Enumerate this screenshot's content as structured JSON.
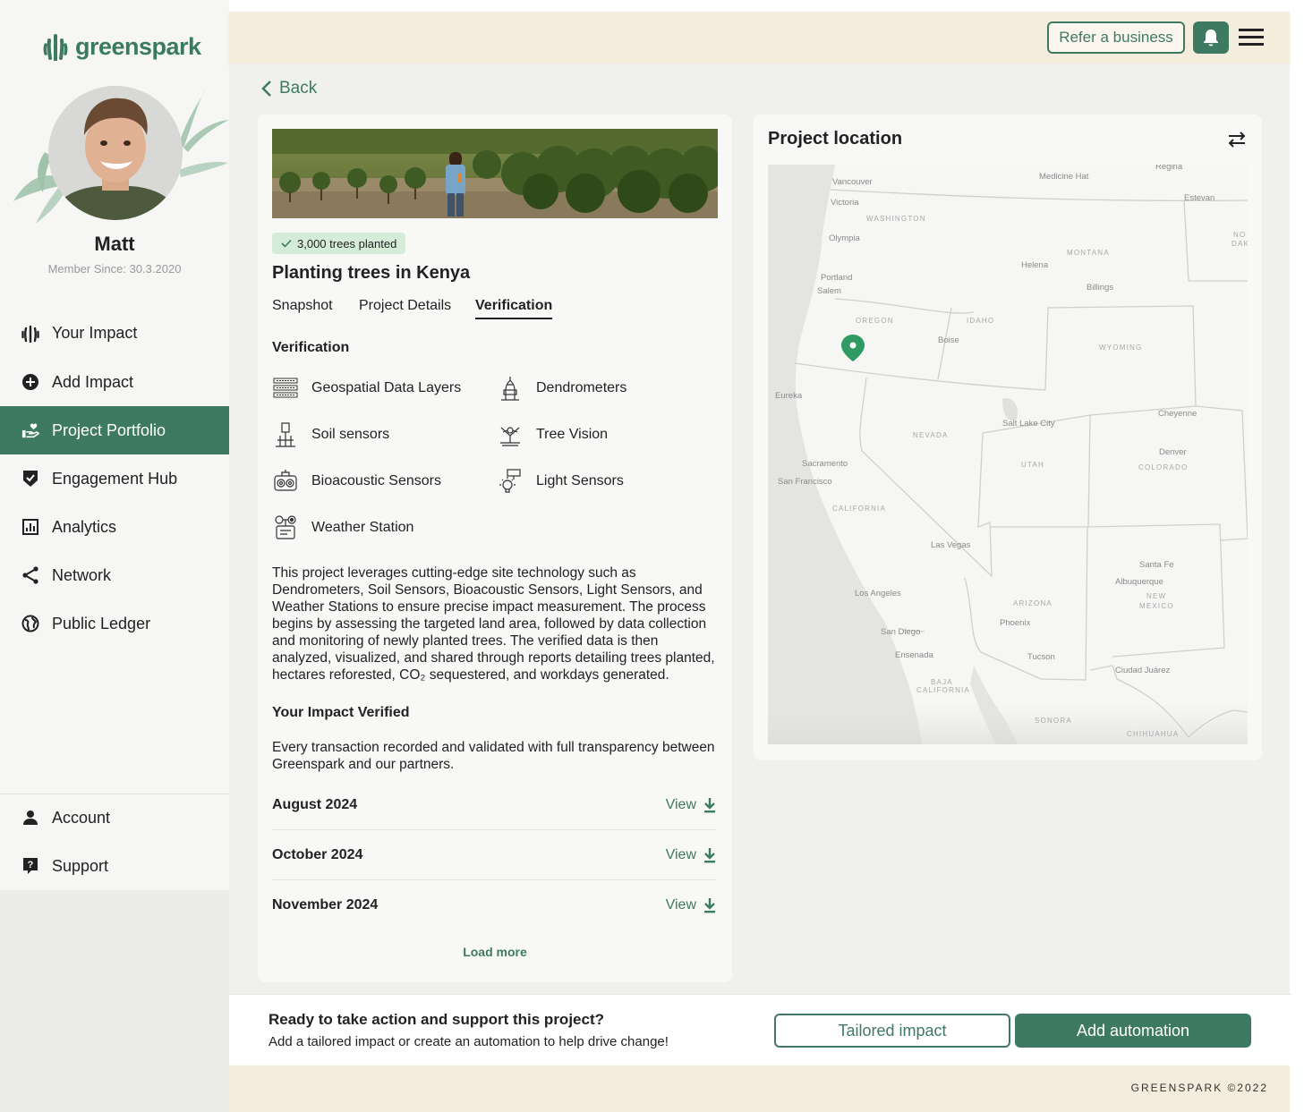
{
  "brand": {
    "name": "greenspark",
    "color": "#3e7a62"
  },
  "profile": {
    "name": "Matt",
    "member_since": "Member Since: 30.3.2020"
  },
  "sidebar": {
    "items": [
      {
        "label": "Your Impact",
        "icon": "hand-plant-icon"
      },
      {
        "label": "Add Impact",
        "icon": "plus-circle-icon"
      },
      {
        "label": "Project Portfolio",
        "icon": "hand-heart-icon",
        "active": true
      },
      {
        "label": "Engagement Hub",
        "icon": "shield-check-icon"
      },
      {
        "label": "Analytics",
        "icon": "bar-chart-icon"
      },
      {
        "label": "Network",
        "icon": "share-icon"
      },
      {
        "label": "Public Ledger",
        "icon": "globe-icon"
      }
    ],
    "bottom_items": [
      {
        "label": "Account",
        "icon": "user-icon"
      },
      {
        "label": "Support",
        "icon": "help-icon"
      }
    ]
  },
  "header": {
    "refer_label": "Refer a business"
  },
  "back_label": "Back",
  "project": {
    "badge": "3,000 trees planted",
    "title": "Planting trees in Kenya",
    "tabs": [
      "Snapshot",
      "Project Details",
      "Verification"
    ],
    "active_tab": "Verification",
    "verification_heading": "Verification",
    "verification_items": [
      {
        "label": "Geospatial Data Layers",
        "icon": "layers-icon"
      },
      {
        "label": "Dendrometers",
        "icon": "dendrometer-icon"
      },
      {
        "label": "Soil sensors",
        "icon": "soil-sensor-icon"
      },
      {
        "label": "Tree Vision",
        "icon": "tree-vision-icon"
      },
      {
        "label": "Bioacoustic Sensors",
        "icon": "bioacoustic-icon"
      },
      {
        "label": "Light Sensors",
        "icon": "light-sensor-icon"
      },
      {
        "label": "Weather Station",
        "icon": "weather-station-icon"
      }
    ],
    "description": "This project leverages cutting-edge site technology such as Dendrometers, Soil Sensors, Bioacoustic Sensors, Light Sensors, and Weather Stations to ensure precise impact measurement. The process begins by assessing the targeted land area, followed by data collection and monitoring of newly planted trees. The verified data is then analyzed, visualized, and shared through reports detailing trees planted, hectares reforested, CO₂ sequestered, and workdays generated.",
    "verified_heading": "Your Impact Verified",
    "verified_text": "Every transaction recorded and validated with full transparency between Greenspark and our partners.",
    "reports": [
      {
        "month": "August 2024",
        "action": "View"
      },
      {
        "month": "October 2024",
        "action": "View"
      },
      {
        "month": "November 2024",
        "action": "View"
      }
    ],
    "load_more": "Load more"
  },
  "map": {
    "title": "Project location",
    "cities": {
      "vancouver": "Vancouver",
      "victoria": "Victoria",
      "olympia": "Olympia",
      "portland": "Portland",
      "salem": "Salem",
      "eureka": "Eureka",
      "sacramento": "Sacramento",
      "sanfrancisco": "San Francisco",
      "boise": "Boise",
      "helena": "Helena",
      "billings": "Billings",
      "medicinehat": "Medicine Hat",
      "regina": "Regina",
      "estevan": "Estevan",
      "saltlake": "Salt Lake City",
      "cheyenne": "Cheyenne",
      "denver": "Denver",
      "lasvegas": "Las Vegas",
      "losangeles": "Los Angeles",
      "sandiego": "San Diego",
      "ensenada": "Ensenada",
      "phoenix": "Phoenix",
      "tucson": "Tucson",
      "santafe": "Santa Fe",
      "albuquerque": "Albuquerque",
      "ciudadjuarez": "Ciudad Juárez"
    },
    "states": {
      "washington": "WASHINGTON",
      "oregon": "OREGON",
      "idaho": "IDAHO",
      "montana": "MONTANA",
      "wyoming": "WYOMING",
      "nevada": "NEVADA",
      "utah": "UTAH",
      "colorado": "COLORADO",
      "california": "CALIFORNIA",
      "arizona": "ARIZONA",
      "newmexico1": "NEW",
      "newmexico2": "MEXICO",
      "baja1": "BAJA",
      "baja2": "CALIFORNIA",
      "sonora": "SONORA",
      "chihuahua": "CHIHUAHUA",
      "northdakota1": "NO",
      "northdakota2": "DAK"
    }
  },
  "cta": {
    "title": "Ready to take action and support this project?",
    "subtitle": "Add a tailored impact or create an automation to help drive change!",
    "tailored_label": "Tailored impact",
    "automation_label": "Add automation"
  },
  "footer": {
    "text": "GREENSPARK ©2022"
  }
}
